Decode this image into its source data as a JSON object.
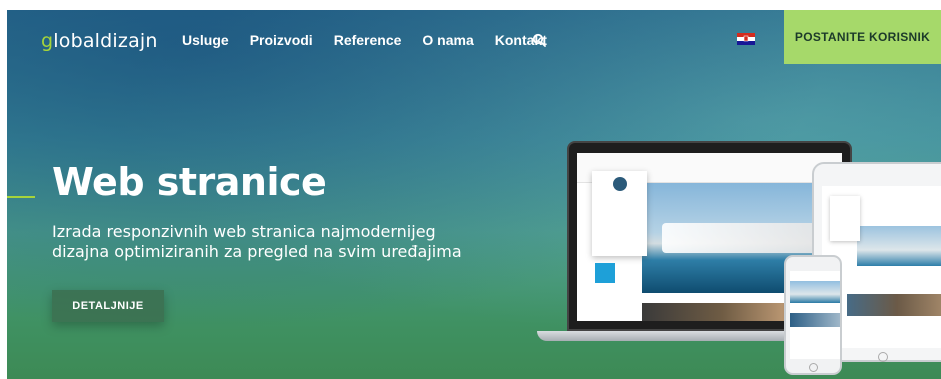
{
  "header": {
    "logo": {
      "first_letter": "g",
      "rest": "lobaldizajn"
    },
    "nav": [
      "Usluge",
      "Proizvodi",
      "Reference",
      "O nama",
      "Kontakt"
    ],
    "cta_label": "POSTANITE KORISNIK",
    "icons": {
      "search": "search-icon",
      "language_flag": "croatia-flag-icon"
    }
  },
  "hero": {
    "title": "Web stranice",
    "subtitle": "Izrada responzivnih web stranica najmodernijeg dizajna optimiziranih za pregled na svim uređajima",
    "button_label": "DETALJNIJE"
  },
  "colors": {
    "accent_green": "#a6d96a",
    "logo_accent": "#a6d43a",
    "hero_gradient_top": "#2b6f8e",
    "hero_gradient_bottom": "#3d8a55"
  }
}
